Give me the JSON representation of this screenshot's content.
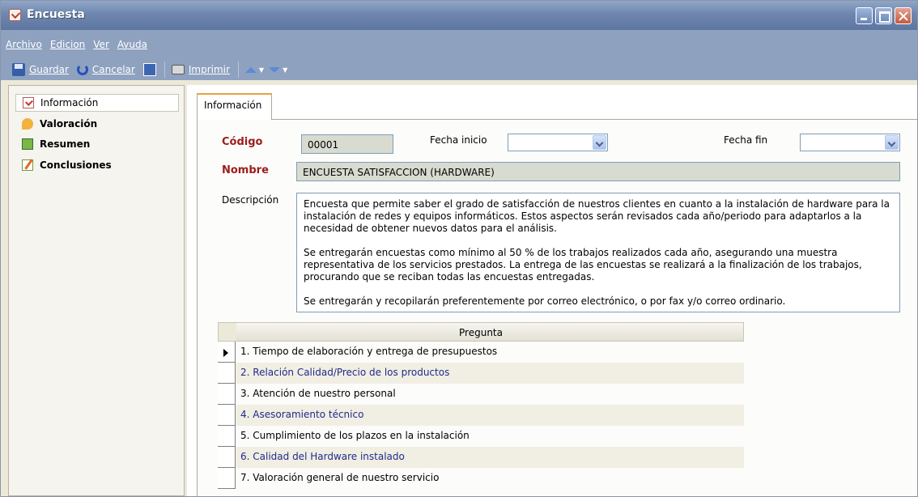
{
  "window": {
    "title": "Encuesta"
  },
  "menu": [
    "Archivo",
    "Edicion",
    "Ver",
    "Ayuda"
  ],
  "toolbar": {
    "save_label": "Guardar",
    "cancel_label": "Cancelar",
    "print_label": "Imprimir"
  },
  "sidebar": {
    "items": [
      {
        "label": "Información",
        "icon": "form-check-icon"
      },
      {
        "label": "Valoración",
        "icon": "rating-icon"
      },
      {
        "label": "Resumen",
        "icon": "chart-icon"
      },
      {
        "label": "Conclusiones",
        "icon": "edit-icon"
      }
    ]
  },
  "tab": {
    "label": "Información"
  },
  "form": {
    "codigo_label": "Código",
    "codigo_value": "00001",
    "fecha_inicio_label": "Fecha inicio",
    "fecha_inicio_value": "",
    "fecha_fin_label": "Fecha fin",
    "fecha_fin_value": "",
    "nombre_label": "Nombre",
    "nombre_value": "ENCUESTA SATISFACCION (HARDWARE)",
    "descripcion_label": "Descripción",
    "descripcion_p1": "Encuesta que permite saber el grado de satisfacción de nuestros clientes en cuanto a la instalación de hardware para la instalación de redes y equipos informáticos. Estos aspectos serán revisados cada año/periodo para adaptarlos a la necesidad de obtener nuevos datos para el análisis.",
    "descripcion_p2": "Se entregarán encuestas como mínimo al 50 % de los trabajos realizados cada año, asegurando una muestra representativa de los servicios prestados. La entrega de las encuestas se realizará a la finalización de los trabajos, procurando que se reciban todas las encuestas entregadas.",
    "descripcion_p3": "Se entregarán y recopilarán preferentemente por correo electrónico, o por fax y/o correo ordinario."
  },
  "grid": {
    "header": "Pregunta",
    "rows": [
      "1. Tiempo de elaboración y entrega de presupuestos",
      "2. Relación Calidad/Precio de los productos",
      "3. Atención de nuestro personal",
      "4. Asesoramiento técnico",
      "5. Cumplimiento de los plazos en la instalación",
      "6. Calidad del Hardware instalado",
      "7. Valoración general de nuestro servicio"
    ]
  }
}
